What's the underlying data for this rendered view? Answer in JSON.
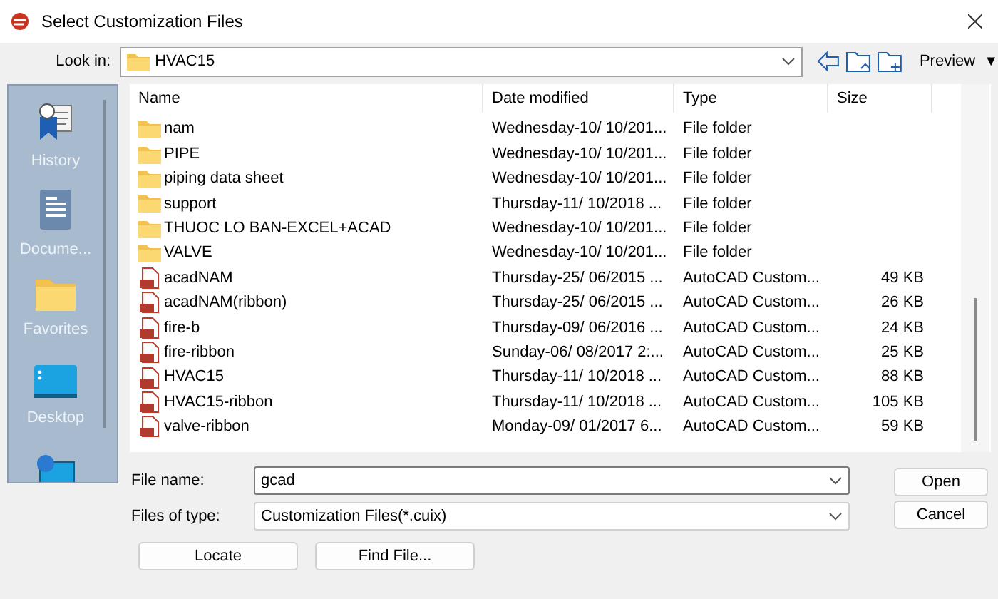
{
  "window": {
    "title": "Select Customization Files"
  },
  "look_in": {
    "label": "Look in:",
    "value": "HVAC15"
  },
  "toolbar": {
    "preview": "Preview",
    "preview_caret": "▼"
  },
  "places": [
    {
      "kind": "history",
      "label": "History"
    },
    {
      "kind": "documents",
      "label": "Docume..."
    },
    {
      "kind": "favorites",
      "label": "Favorites"
    },
    {
      "kind": "desktop",
      "label": "Desktop"
    },
    {
      "kind": "network"
    }
  ],
  "table": {
    "columns": [
      "Name",
      "Date modified",
      "Type",
      "Size"
    ],
    "rows": [
      {
        "kind": "folder",
        "name": "nam",
        "date": "Wednesday-10/ 10/201...",
        "type": "File folder"
      },
      {
        "kind": "folder",
        "name": "PIPE",
        "date": "Wednesday-10/ 10/201...",
        "type": "File folder"
      },
      {
        "kind": "folder",
        "name": "piping data sheet",
        "date": "Wednesday-10/ 10/201...",
        "type": "File folder"
      },
      {
        "kind": "folder",
        "name": "support",
        "date": "Thursday-11/ 10/2018 ...",
        "type": "File folder"
      },
      {
        "kind": "folder",
        "name": "THUOC LO BAN-EXCEL+ACAD",
        "date": "Wednesday-10/ 10/201...",
        "type": "File folder"
      },
      {
        "kind": "folder",
        "name": "VALVE",
        "date": "Wednesday-10/ 10/201...",
        "type": "File folder"
      },
      {
        "kind": "cuix",
        "name": "acadNAM",
        "date": "Thursday-25/ 06/2015 ...",
        "type": "AutoCAD Custom...",
        "size": "49 KB"
      },
      {
        "kind": "cuix",
        "name": "acadNAM(ribbon)",
        "date": "Thursday-25/ 06/2015 ...",
        "type": "AutoCAD Custom...",
        "size": "26 KB"
      },
      {
        "kind": "cuix",
        "name": "fire-b",
        "date": "Thursday-09/ 06/2016 ...",
        "type": "AutoCAD Custom...",
        "size": "24 KB"
      },
      {
        "kind": "cuix",
        "name": "fire-ribbon",
        "date": "Sunday-06/ 08/2017 2:...",
        "type": "AutoCAD Custom...",
        "size": "25 KB"
      },
      {
        "kind": "cuix",
        "name": "HVAC15",
        "date": "Thursday-11/ 10/2018 ...",
        "type": "AutoCAD Custom...",
        "size": "88 KB"
      },
      {
        "kind": "cuix",
        "name": "HVAC15-ribbon",
        "date": "Thursday-11/ 10/2018 ...",
        "type": "AutoCAD Custom...",
        "size": "105 KB"
      },
      {
        "kind": "cuix",
        "name": "valve-ribbon",
        "date": "Monday-09/ 01/2017 6...",
        "type": "AutoCAD Custom...",
        "size": "59 KB"
      }
    ]
  },
  "file_name": {
    "label": "File name:",
    "value": "gcad"
  },
  "file_type": {
    "label": "Files of type:",
    "value": "Customization Files(*.cuix)"
  },
  "buttons": {
    "open": "Open",
    "cancel": "Cancel",
    "locate": "Locate",
    "find": "Find File..."
  }
}
